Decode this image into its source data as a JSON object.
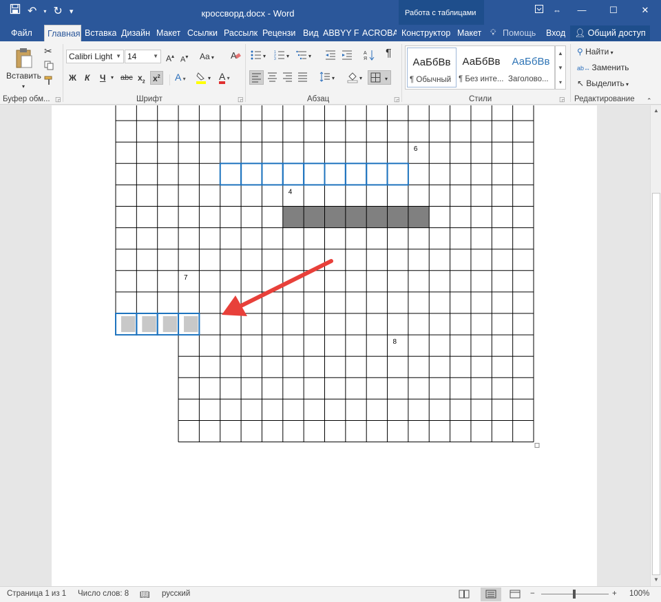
{
  "window": {
    "title": "кроссворд.docx - Word",
    "context_header": "Работа с таблицами",
    "ribbon_display_icon": "ribbon-display-options-icon",
    "resize_icon": "resize-arrows-icon"
  },
  "tabs": [
    {
      "label": "Файл"
    },
    {
      "label": "Главная",
      "active": true
    },
    {
      "label": "Вставка"
    },
    {
      "label": "Дизайн"
    },
    {
      "label": "Макет"
    },
    {
      "label": "Ссылки"
    },
    {
      "label": "Рассылк"
    },
    {
      "label": "Рецензи"
    },
    {
      "label": "Вид"
    },
    {
      "label": "ABBYY Fi"
    },
    {
      "label": "ACROBA"
    },
    {
      "label": "Конструктор"
    },
    {
      "label": "Макет"
    },
    {
      "label": "Помощь"
    },
    {
      "label": "Вход"
    }
  ],
  "share_label": "Общий доступ",
  "ribbon": {
    "paste_label": "Вставить",
    "font_name": "Calibri Light",
    "font_size": "14",
    "change_case": "Aa",
    "bold": "Ж",
    "italic": "К",
    "underline": "Ч",
    "strikethrough": "abc",
    "subscript": "x",
    "superscript": "x",
    "text_effect": "A",
    "font_color": "A",
    "paragraph_mark": "¶",
    "find_label": "Найти",
    "replace_label": "Заменить",
    "select_label": "Выделить",
    "groups": {
      "clipboard": "Буфер обм...",
      "font": "Шрифт",
      "paragraph": "Абзац",
      "styles": "Стили",
      "editing": "Редактирование"
    },
    "styles": [
      {
        "preview": "АаБбВв",
        "name": "¶ Обычный"
      },
      {
        "preview": "АаБбВв",
        "name": "¶ Без инте..."
      },
      {
        "preview": "АаБбВв",
        "name": "Заголово..."
      }
    ]
  },
  "crossword": {
    "columns": 20,
    "rows": 16,
    "numbers": [
      {
        "row": 2,
        "col": 14,
        "text": "6"
      },
      {
        "row": 4,
        "col": 8,
        "text": "4"
      },
      {
        "row": 8,
        "col": 3,
        "text": "7"
      },
      {
        "row": 11,
        "col": 13,
        "text": "8"
      }
    ],
    "highlighted_blue_word": {
      "row": 3,
      "col_start": 5,
      "length": 9,
      "color": "#1e73be"
    },
    "dark_fill_word": {
      "row": 5,
      "col_start": 8,
      "length": 7,
      "color": "#808080"
    },
    "selected_word": {
      "row": 10,
      "col_start": 0,
      "length": 4,
      "color": "#c8c8c8"
    },
    "merged_left_from_row": 11,
    "merged_left_cols": 3,
    "arrow_color": "#e8403a"
  },
  "status": {
    "page": "Страница 1 из 1",
    "words": "Число слов: 8",
    "language": "русский",
    "zoom": "100%",
    "zoom_minus": "−",
    "zoom_plus": "+"
  }
}
